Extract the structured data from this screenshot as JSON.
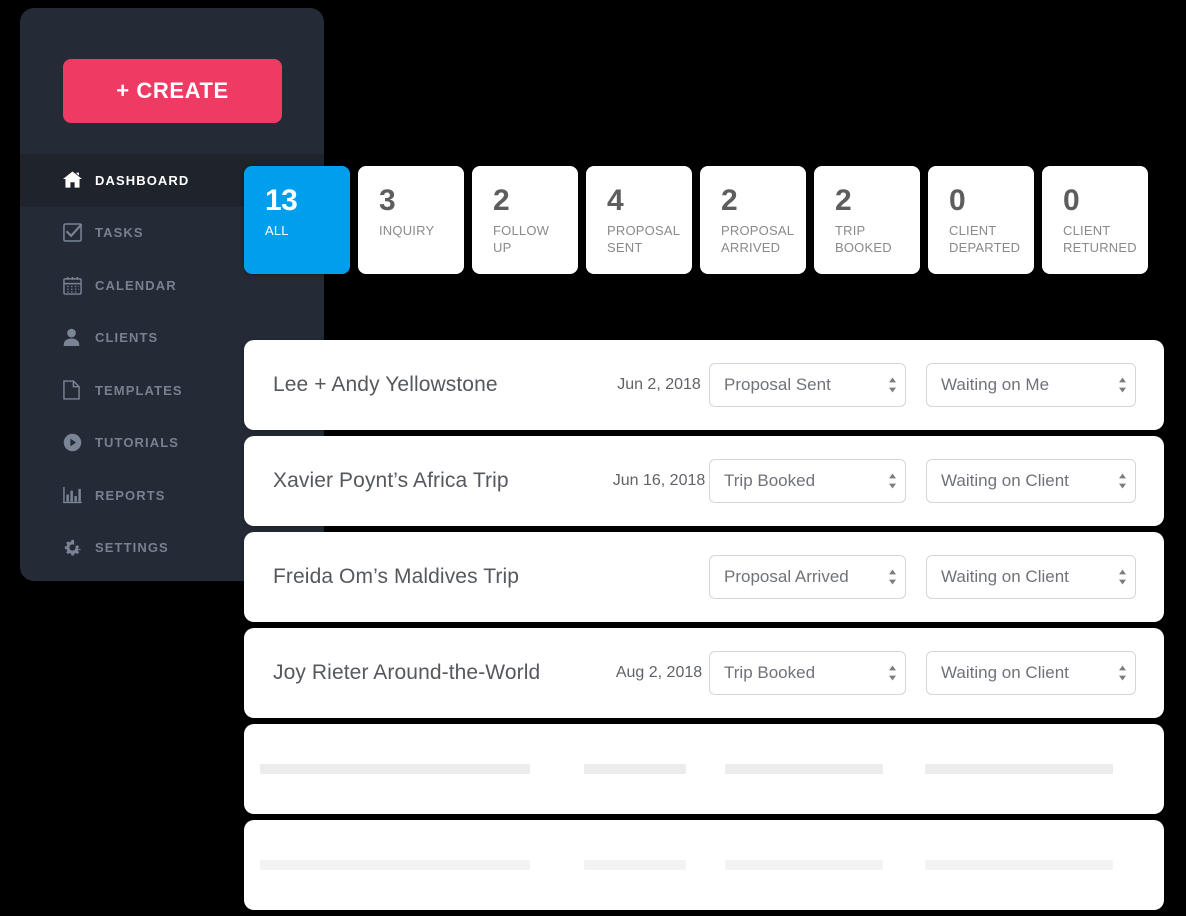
{
  "theme": {
    "page_background": "#000000",
    "sidebar_background": "#252b36",
    "sidebar_active_background": "#1e232c",
    "accent_pink": "#ef3a63",
    "accent_blue": "#009fee",
    "card_white": "#ffffff",
    "skeleton_gray": "#ececec"
  },
  "sidebar": {
    "create_button_label": "+ CREATE",
    "items": [
      {
        "label": "DASHBOARD",
        "icon": "home-icon",
        "active": true
      },
      {
        "label": "TASKS",
        "icon": "checkbox-icon",
        "active": false
      },
      {
        "label": "CALENDAR",
        "icon": "calendar-icon",
        "active": false
      },
      {
        "label": "CLIENTS",
        "icon": "person-icon",
        "active": false
      },
      {
        "label": "TEMPLATES",
        "icon": "document-icon",
        "active": false
      },
      {
        "label": "TUTORIALS",
        "icon": "play-circle-icon",
        "active": false
      },
      {
        "label": "REPORTS",
        "icon": "bar-chart-icon",
        "active": false
      },
      {
        "label": "SETTINGS",
        "icon": "gear-icon",
        "active": false
      }
    ]
  },
  "stats": [
    {
      "count": "13",
      "label": "ALL",
      "active": true
    },
    {
      "count": "3",
      "label": "INQUIRY",
      "active": false
    },
    {
      "count": "2",
      "label": "FOLLOW UP",
      "active": false
    },
    {
      "count": "4",
      "label": "PROPOSAL SENT",
      "active": false
    },
    {
      "count": "2",
      "label": "PROPOSAL ARRIVED",
      "active": false
    },
    {
      "count": "2",
      "label": "TRIP BOOKED",
      "active": false
    },
    {
      "count": "0",
      "label": "CLIENT DEPARTED",
      "active": false
    },
    {
      "count": "0",
      "label": "CLIENT RETURNED",
      "active": false
    }
  ],
  "trips": [
    {
      "name": "Lee + Andy Yellowstone",
      "date": "Jun 2, 2018",
      "status": "Proposal Sent",
      "waiting": "Waiting on Me"
    },
    {
      "name": "Xavier Poynt’s Africa Trip",
      "date": "Jun 16, 2018",
      "status": "Trip Booked",
      "waiting": "Waiting on Client"
    },
    {
      "name": "Freida Om’s Maldives Trip",
      "date": "",
      "status": "Proposal Arrived",
      "waiting": "Waiting on Client"
    },
    {
      "name": "Joy Rieter Around-the-World",
      "date": "Aug 2, 2018",
      "status": "Trip Booked",
      "waiting": "Waiting on Client"
    }
  ],
  "skeleton_rows": [
    {
      "faded": false
    },
    {
      "faded": true
    }
  ]
}
